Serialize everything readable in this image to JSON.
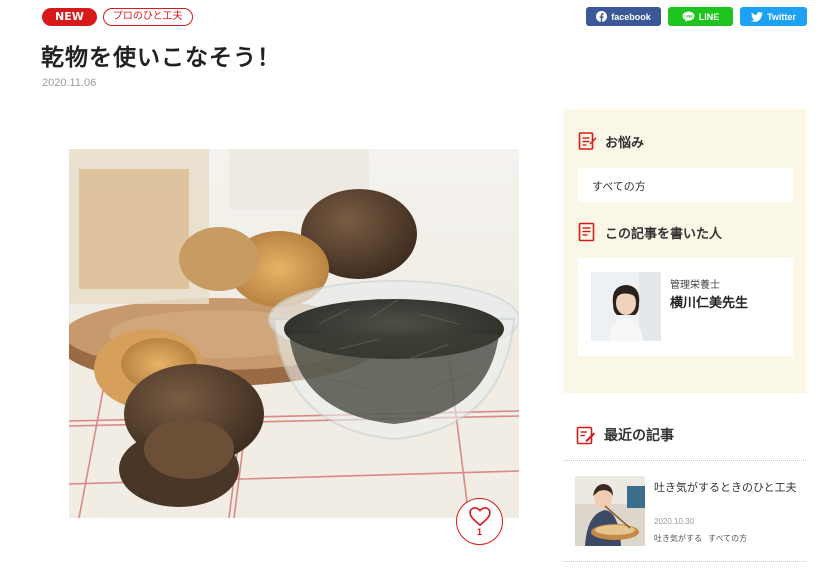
{
  "article": {
    "badge_new": "NEW",
    "category": "プロのひと工夫",
    "title": "乾物を使いこなそう！",
    "date": "2020.11.06",
    "likes": "1"
  },
  "share": {
    "facebook": "facebook",
    "line": "LINE",
    "twitter": "Twitter"
  },
  "sidebar": {
    "worry_heading": "お悩み",
    "worry_item": "すべての方",
    "author_heading": "この記事を書いた人",
    "author_role": "管理栄養士",
    "author_name": "横川仁美先生"
  },
  "recent": {
    "heading": "最近の記事",
    "items": [
      {
        "title": "吐き気がするときのひと工夫",
        "date": "2020.10.30",
        "tags": [
          "吐き気がする",
          "すべての方"
        ]
      }
    ]
  },
  "colors": {
    "accent": "#d7191c",
    "facebook": "#3b5998",
    "line": "#1ec51e",
    "twitter": "#1da1f2",
    "panel_bg": "#fbf7e6"
  }
}
